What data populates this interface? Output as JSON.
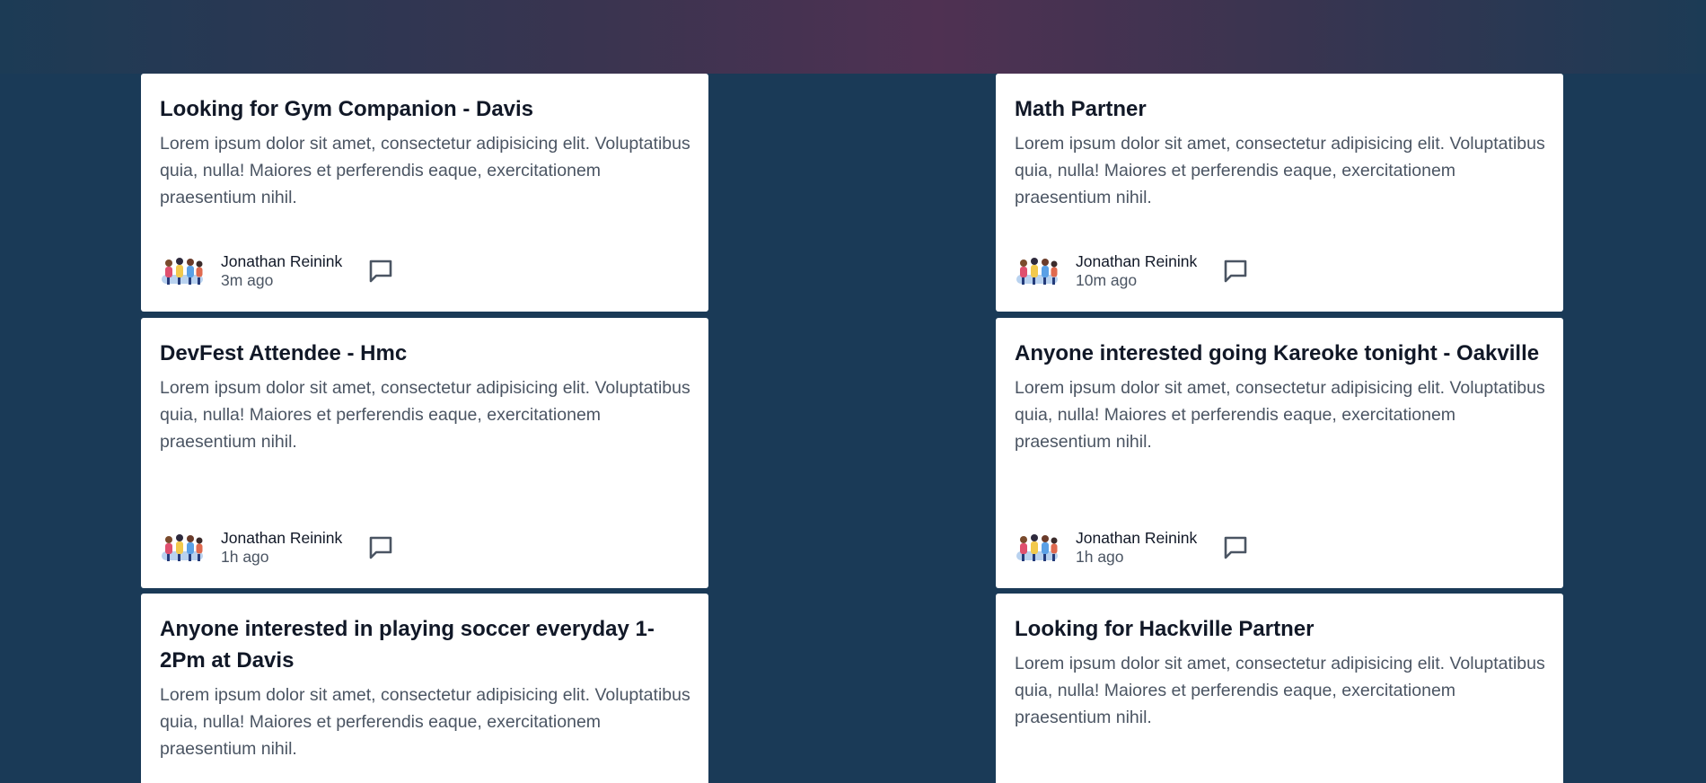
{
  "posts": [
    {
      "title": "Looking for Gym Companion - Davis",
      "body": "Lorem ipsum dolor sit amet, consectetur adipisicing elit. Voluptatibus quia, nulla! Maiores et perferendis eaque, exercitationem praesentium nihil.",
      "author": "Jonathan Reinink",
      "time": "3m ago"
    },
    {
      "title": "Math Partner",
      "body": "Lorem ipsum dolor sit amet, consectetur adipisicing elit. Voluptatibus quia, nulla! Maiores et perferendis eaque, exercitationem praesentium nihil.",
      "author": "Jonathan Reinink",
      "time": "10m ago"
    },
    {
      "title": "DevFest Attendee - Hmc",
      "body": "Lorem ipsum dolor sit amet, consectetur adipisicing elit. Voluptatibus quia, nulla! Maiores et perferendis eaque, exercitationem praesentium nihil.",
      "author": "Jonathan Reinink",
      "time": "1h ago"
    },
    {
      "title": "Anyone interested going Kareoke tonight - Oakville",
      "body": "Lorem ipsum dolor sit amet, consectetur adipisicing elit. Voluptatibus quia, nulla! Maiores et perferendis eaque, exercitationem praesentium nihil.",
      "author": "Jonathan Reinink",
      "time": "1h ago"
    },
    {
      "title": "Anyone interested in playing soccer everyday 1-2Pm at Davis",
      "body": "Lorem ipsum dolor sit amet, consectetur adipisicing elit. Voluptatibus quia, nulla! Maiores et perferendis eaque, exercitationem praesentium nihil."
    },
    {
      "title": "Looking for Hackville Partner",
      "body": "Lorem ipsum dolor sit amet, consectetur adipisicing elit. Voluptatibus quia, nulla! Maiores et perferendis eaque, exercitationem praesentium nihil."
    }
  ],
  "icons": {
    "avatar": "avatar-illustration",
    "comment": "comment-icon"
  },
  "colors": {
    "background": "#1a3a57",
    "card": "#ffffff",
    "title": "#111827",
    "body": "#4b5563"
  }
}
